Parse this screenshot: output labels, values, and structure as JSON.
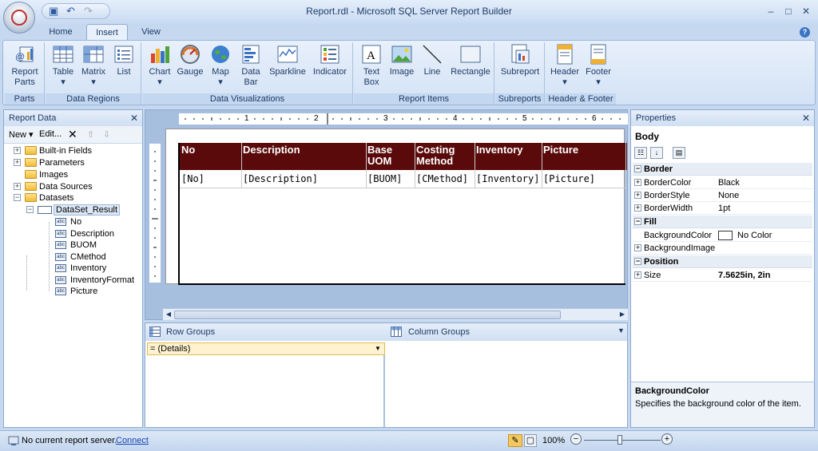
{
  "window": {
    "title": "Report.rdl - Microsoft SQL Server Report Builder",
    "minimize_glyph": "–",
    "maximize_glyph": "□",
    "close_glyph": "✕"
  },
  "quick_access": {
    "save_icon": "save-icon",
    "undo_icon": "undo-icon",
    "redo_icon": "redo-icon"
  },
  "tabs": [
    {
      "label": "Home",
      "active": false
    },
    {
      "label": "Insert",
      "active": true
    },
    {
      "label": "View",
      "active": false
    }
  ],
  "ribbon": {
    "groups": [
      {
        "label": "Parts",
        "buttons": [
          {
            "label": "Report\nParts",
            "icon": "report-parts-icon"
          }
        ]
      },
      {
        "label": "Data Regions",
        "buttons": [
          {
            "label": "Table\n▾",
            "icon": "table-icon"
          },
          {
            "label": "Matrix\n▾",
            "icon": "matrix-icon"
          },
          {
            "label": "List",
            "icon": "list-icon"
          }
        ]
      },
      {
        "label": "Data Visualizations",
        "buttons": [
          {
            "label": "Chart\n▾",
            "icon": "chart-icon"
          },
          {
            "label": "Gauge",
            "icon": "gauge-icon"
          },
          {
            "label": "Map\n▾",
            "icon": "map-icon"
          },
          {
            "label": "Data\nBar",
            "icon": "data-bar-icon"
          },
          {
            "label": "Sparkline",
            "icon": "sparkline-icon"
          },
          {
            "label": "Indicator",
            "icon": "indicator-icon"
          }
        ]
      },
      {
        "label": "Report Items",
        "buttons": [
          {
            "label": "Text\nBox",
            "icon": "text-box-icon"
          },
          {
            "label": "Image",
            "icon": "image-icon"
          },
          {
            "label": "Line",
            "icon": "line-icon"
          },
          {
            "label": "Rectangle",
            "icon": "rectangle-icon"
          }
        ]
      },
      {
        "label": "Subreports",
        "buttons": [
          {
            "label": "Subreport",
            "icon": "subreport-icon"
          }
        ]
      },
      {
        "label": "Header & Footer",
        "buttons": [
          {
            "label": "Header\n▾",
            "icon": "header-icon"
          },
          {
            "label": "Footer\n▾",
            "icon": "footer-icon"
          }
        ]
      }
    ]
  },
  "report_data": {
    "title": "Report Data",
    "close_glyph": "✕",
    "toolbar": {
      "new_label": "New ▾",
      "edit_label": "Edit...",
      "delete_glyph": "✕",
      "up_glyph": "⇧",
      "down_glyph": "⇩"
    },
    "tree": [
      {
        "label": "Built-in Fields",
        "type": "folder",
        "expander": "+"
      },
      {
        "label": "Parameters",
        "type": "folder",
        "expander": "+"
      },
      {
        "label": "Images",
        "type": "folder",
        "expander": ""
      },
      {
        "label": "Data Sources",
        "type": "folder",
        "expander": "+"
      },
      {
        "label": "Datasets",
        "type": "folder",
        "expander": "−"
      },
      {
        "label": "DataSet_Result",
        "type": "dataset",
        "expander": "−"
      },
      {
        "label": "No",
        "type": "field"
      },
      {
        "label": "Description",
        "type": "field"
      },
      {
        "label": "BUOM",
        "type": "field"
      },
      {
        "label": "CMethod",
        "type": "field"
      },
      {
        "label": "Inventory",
        "type": "field"
      },
      {
        "label": "InventoryFormat",
        "type": "field"
      },
      {
        "label": "Picture",
        "type": "field"
      }
    ]
  },
  "ruler": {
    "marks": [
      "1",
      "2",
      "3",
      "4",
      "5",
      "6"
    ]
  },
  "report_table": {
    "headers": [
      "No",
      "Description",
      "Base\nUOM",
      "Costing\nMethod",
      "Inventory",
      "Picture"
    ],
    "cells": [
      "[No]",
      "[Description]",
      "[BUOM]",
      "[CMethod]",
      "[Inventory]",
      "[Picture]"
    ],
    "header_color": "#5a0a0a"
  },
  "groups": {
    "row_groups_label": "Row Groups",
    "column_groups_label": "Column Groups",
    "details_label": "= (Details)"
  },
  "properties": {
    "title": "Properties",
    "close_glyph": "✕",
    "object_name": "Body",
    "categories": [
      {
        "name": "Border",
        "rows": [
          {
            "name": "BorderColor",
            "value": "Black",
            "expandable": true
          },
          {
            "name": "BorderStyle",
            "value": "None",
            "expandable": true
          },
          {
            "name": "BorderWidth",
            "value": "1pt",
            "expandable": true
          }
        ]
      },
      {
        "name": "Fill",
        "rows": [
          {
            "name": "BackgroundColor",
            "value": "No Color",
            "expandable": false
          },
          {
            "name": "BackgroundImage",
            "value": "",
            "expandable": true
          }
        ]
      },
      {
        "name": "Position",
        "rows": [
          {
            "name": "Size",
            "value": "7.5625in, 2in",
            "expandable": true
          }
        ]
      }
    ],
    "description_name": "BackgroundColor",
    "description_text": "Specifies the background color of the item."
  },
  "status": {
    "server_text": "No current report server.",
    "connect_label": "Connect",
    "zoom": "100%",
    "zoom_minus": "−",
    "zoom_plus": "+"
  }
}
